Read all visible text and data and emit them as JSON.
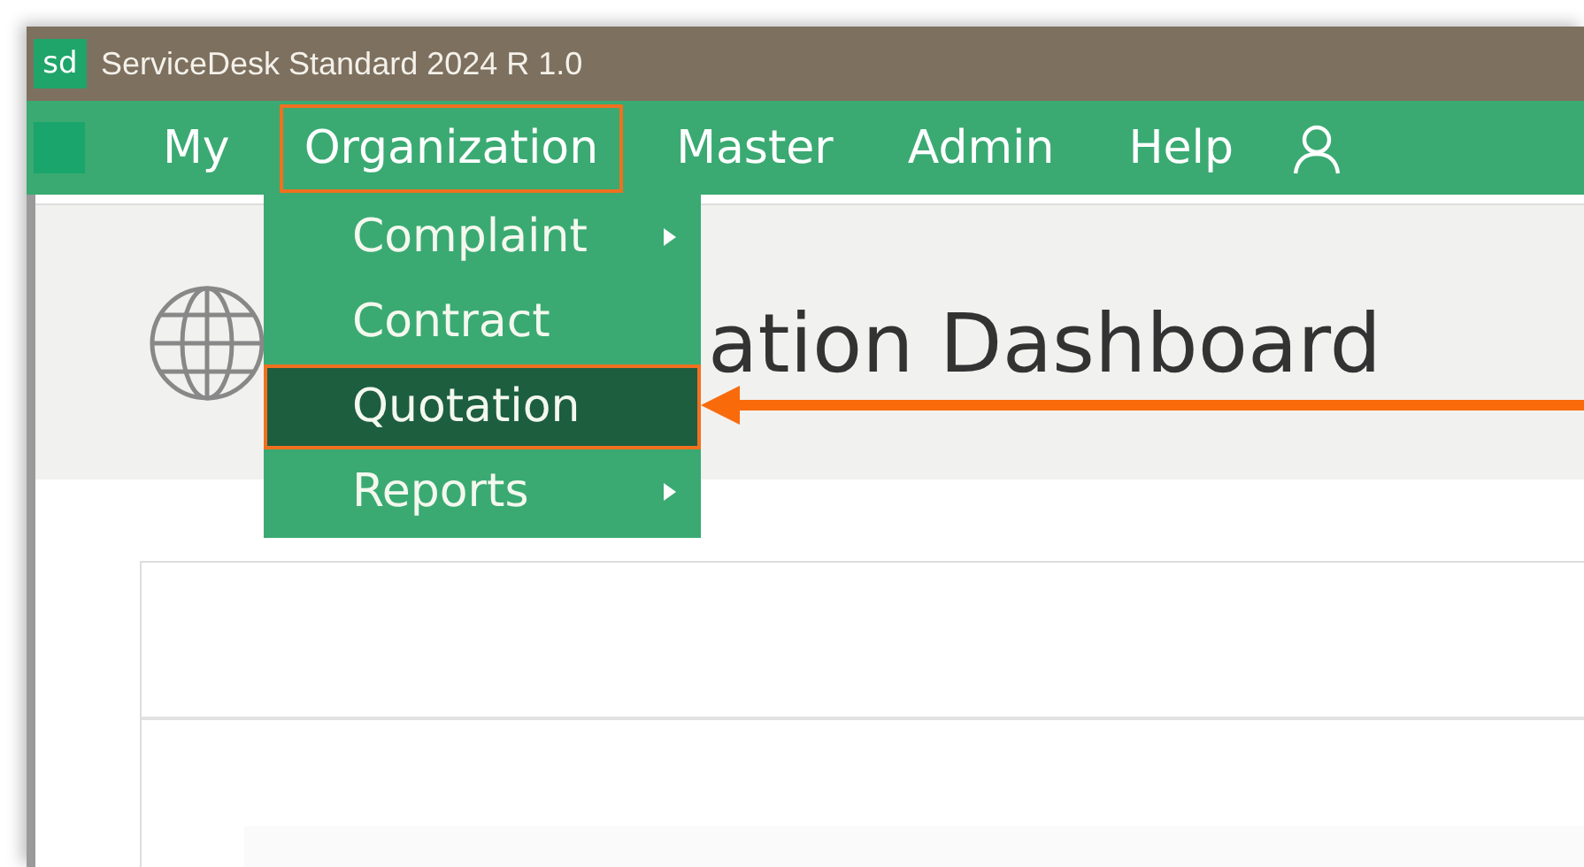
{
  "window": {
    "app_icon": "sd",
    "title": "ServiceDesk Standard 2024 R 1.0"
  },
  "menu_bar": {
    "items": [
      {
        "label": "My",
        "selected": false
      },
      {
        "label": "Organization",
        "selected": true
      },
      {
        "label": "Master",
        "selected": false
      },
      {
        "label": "Admin",
        "selected": false
      },
      {
        "label": "Help",
        "selected": false
      }
    ]
  },
  "dropdown": {
    "items": [
      {
        "label": "Complaint",
        "has_submenu": true,
        "selected": false
      },
      {
        "label": "Contract",
        "has_submenu": false,
        "selected": false
      },
      {
        "label": "Quotation",
        "has_submenu": false,
        "selected": true
      },
      {
        "label": "Reports",
        "has_submenu": true,
        "selected": false
      }
    ]
  },
  "page": {
    "title": "ation Dashboard"
  }
}
